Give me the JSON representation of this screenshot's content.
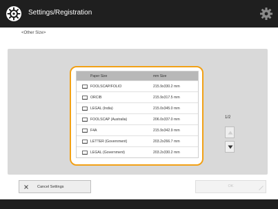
{
  "header": {
    "title": "Settings/Registration"
  },
  "subtitle": "<Other Size>",
  "list": {
    "col_name": "Paper Size",
    "col_size": "mm Size",
    "rows": [
      {
        "name": "FOOLSCAP/FOLIO",
        "size": "215.9x330.2 mm"
      },
      {
        "name": "ORCIB",
        "size": "215.9x317.5 mm"
      },
      {
        "name": "LEGAL (India)",
        "size": "215.0x345.0 mm"
      },
      {
        "name": "FOOLSCAP (Australia)",
        "size": "206.0x337.0 mm"
      },
      {
        "name": "F4A",
        "size": "215.9x342.9 mm"
      },
      {
        "name": "LETTER (Government)",
        "size": "203.2x266.7 mm"
      },
      {
        "name": "LEGAL (Government)",
        "size": "203.2x330.2 mm"
      }
    ]
  },
  "pager": {
    "text": "1/2"
  },
  "footer": {
    "cancel_label": "Cancel Settings",
    "ok_label": "OK"
  },
  "colors": {
    "accent": "#f2a014",
    "panel": "#d9d9d9",
    "bar": "#1f1f1f"
  }
}
